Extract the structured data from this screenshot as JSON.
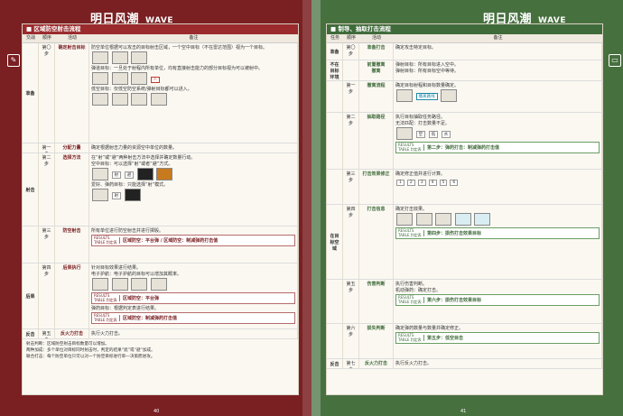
{
  "colors": {
    "left_bg": "#7a1f22",
    "right_bg": "#47703f",
    "left_accent": "#9b2a2d",
    "right_accent": "#3f6b3a"
  },
  "brand": {
    "name": "明日风潮",
    "sub": "WAVE"
  },
  "left": {
    "title": "■ 区域防空射击流程",
    "headers": [
      "交战",
      "顺序",
      "活动",
      "备注"
    ],
    "rows": [
      {
        "phase": "准备",
        "step": "第〇步",
        "act": "确定射击目标",
        "note": "防空单位根据可以攻击的目标射击区域，一个空中目标（不在雷达范围）视为一个目标。"
      },
      {
        "phase": "",
        "step": "",
        "act": "",
        "note": "弹道目标：一旦处于射程内所有单位，均有直接射击能力的部分目标视为可以被射中。"
      },
      {
        "phase": "",
        "step": "",
        "act": "",
        "note": "低空目标：仅低空防空系统/弹射目标都可以进入。"
      },
      {
        "phase": "",
        "step": "第一步",
        "act": "分配力量",
        "note": "确定根据射击力量的资源空中单位的数量。"
      },
      {
        "phase": "射击",
        "step": "第二步",
        "act": "选择方法",
        "note": "在“射”或“避”两种射击方法中选择并确定数量行动。"
      },
      {
        "phase": "",
        "step": "",
        "act": "",
        "note": "空中目标：可以选择“射”或者“避”方式。"
      },
      {
        "phase": "",
        "step": "",
        "act": "",
        "note": "爱好、弹药目标：只能选择“射”模式。"
      },
      {
        "phase": "",
        "step": "第三步",
        "act": "防空射击",
        "note": "所有单位进行防空射击并进行掷骰。"
      },
      {
        "phase": "",
        "step": "",
        "act": "",
        "note": "区域防空：平台弹 / 区域防空：制减弹药打击值"
      },
      {
        "phase": "后果",
        "step": "第四步",
        "act": "后果执行",
        "note": "针对目标效果进行结果。"
      },
      {
        "phase": "",
        "step": "",
        "act": "",
        "note": "电子护航：电子护航的目标可以增加其概率。"
      },
      {
        "phase": "",
        "step": "",
        "act": "",
        "note": "弹药目标：根据判定表进行结果。"
      },
      {
        "phase": "反击",
        "step": "第五步",
        "act": "反火力打击",
        "note": "执行火力打击。"
      }
    ],
    "results": [
      {
        "label": "RESULTS TABLE 判定表",
        "value": "区域防空：平台弹"
      },
      {
        "label": "RESULTS TABLE 判定表",
        "value": "区域防空：平台弹 / 区域防空：制减弹药打击值"
      },
      {
        "label": "RESULTS TABLE 判定表",
        "value": "区域防空：平台弹"
      },
      {
        "label": "RESULTS TABLE 判定表",
        "value": "区域防空：制减弹药打击值"
      }
    ],
    "footer": [
      "射击判断：区域防空射击目标数量可以增加。",
      "两种加成：多个单位对目标同时射击时，判定的结果“遮”或“避”加成。",
      "联合打击：每个防空单位只可以对一个防空目标进行单一决策而进攻。"
    ],
    "page_no": "40"
  },
  "right": {
    "title": "■ 制导、抽取打击流程",
    "headers": [
      "任务",
      "顺序",
      "活动",
      "备注"
    ],
    "rows": [
      {
        "phase": "准备",
        "step": "第〇步",
        "act": "准备打击",
        "note": "确定攻击特定目标。"
      },
      {
        "phase": "不在目标环境",
        "step": "",
        "act": "前置撤离",
        "note": "弹射目标：所有目标进入空中。"
      },
      {
        "phase": "",
        "step": "",
        "act": "撤离",
        "note": "弹射目标：所有目标空中等待。"
      },
      {
        "phase": "",
        "step": "第一步",
        "act": "撤离流程",
        "note": "确定目标射程和目标数量确定。"
      },
      {
        "phase": "",
        "step": "第二步",
        "act": "抽取路径",
        "note": "执行目标抽取任务路径。"
      },
      {
        "phase": "",
        "step": "",
        "act": "",
        "note": "无法匹配：打击数量不足。"
      },
      {
        "phase": "",
        "step": "第三步",
        "act": "打击效果修正",
        "note": "确定修正值并进行计算。"
      },
      {
        "phase": "在目标空域",
        "step": "第四步",
        "act": "打击信息",
        "note": "确定打击效果。"
      },
      {
        "phase": "",
        "step": "第五步",
        "act": "伤害判断",
        "note": "执行伤害判断。"
      },
      {
        "phase": "",
        "step": "",
        "act": "",
        "note": "机动弹药：确定打击。"
      },
      {
        "phase": "",
        "step": "第六步",
        "act": "损失判断",
        "note": "确定弹药数量与数量并确定修正。"
      },
      {
        "phase": "反击",
        "step": "第七步",
        "act": "反火力打击",
        "note": "执行反火力打击。"
      }
    ],
    "results": [
      {
        "label": "RESULTS TABLE 判定表",
        "value": "第二步：弹药打击：制减弹药打击值"
      },
      {
        "label": "RESULTS TABLE 判定表",
        "value": "第四步：损伤打击效果目标"
      },
      {
        "label": "RESULTS TABLE 判定表",
        "value": "第五步：抽取目标"
      },
      {
        "label": "RESULTS TABLE 判定表",
        "value": "第六步：损伤打击效果目标"
      },
      {
        "label": "RESULTS TABLE 判定表",
        "value": "第五步：低空目击"
      }
    ],
    "page_no": "41"
  }
}
